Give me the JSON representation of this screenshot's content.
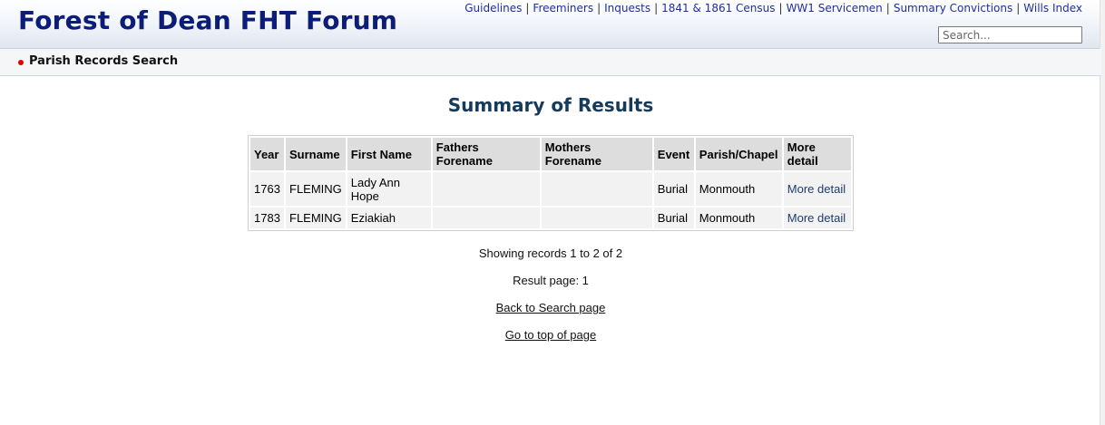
{
  "header": {
    "site_title": "Forest of Dean FHT Forum",
    "nav": [
      {
        "label": "Guidelines"
      },
      {
        "label": "Freeminers"
      },
      {
        "label": "Inquests"
      },
      {
        "label": "1841 & 1861 Census"
      },
      {
        "label": "WW1 Servicemen"
      },
      {
        "label": "Summary Convictions"
      },
      {
        "label": "Wills Index"
      }
    ],
    "search_placeholder": "Search..."
  },
  "breadcrumb": {
    "label": "Parish Records Search"
  },
  "main": {
    "title": "Summary of Results",
    "table": {
      "headers": [
        "Year",
        "Surname",
        "First Name",
        "Fathers Forename",
        "Mothers Forename",
        "Event",
        "Parish/Chapel",
        "More detail"
      ],
      "rows": [
        {
          "year": "1763",
          "surname": "FLEMING",
          "first_name": "Lady Ann Hope",
          "fathers_forename": "",
          "mothers_forename": "",
          "event": "Burial",
          "parish": "Monmouth",
          "more": "More detail"
        },
        {
          "year": "1783",
          "surname": "FLEMING",
          "first_name": "Eziakiah",
          "fathers_forename": "",
          "mothers_forename": "",
          "event": "Burial",
          "parish": "Monmouth",
          "more": "More detail"
        }
      ]
    },
    "showing_text": "Showing records 1 to 2 of 2",
    "result_page_text": "Result page: 1",
    "back_link": "Back to Search page",
    "top_link": "Go to top of page"
  },
  "colors": {
    "title_blue": "#0b1d78",
    "heading_blue": "#163a5a",
    "nav_link": "#1f2f9a",
    "bullet_red": "#e00000"
  }
}
